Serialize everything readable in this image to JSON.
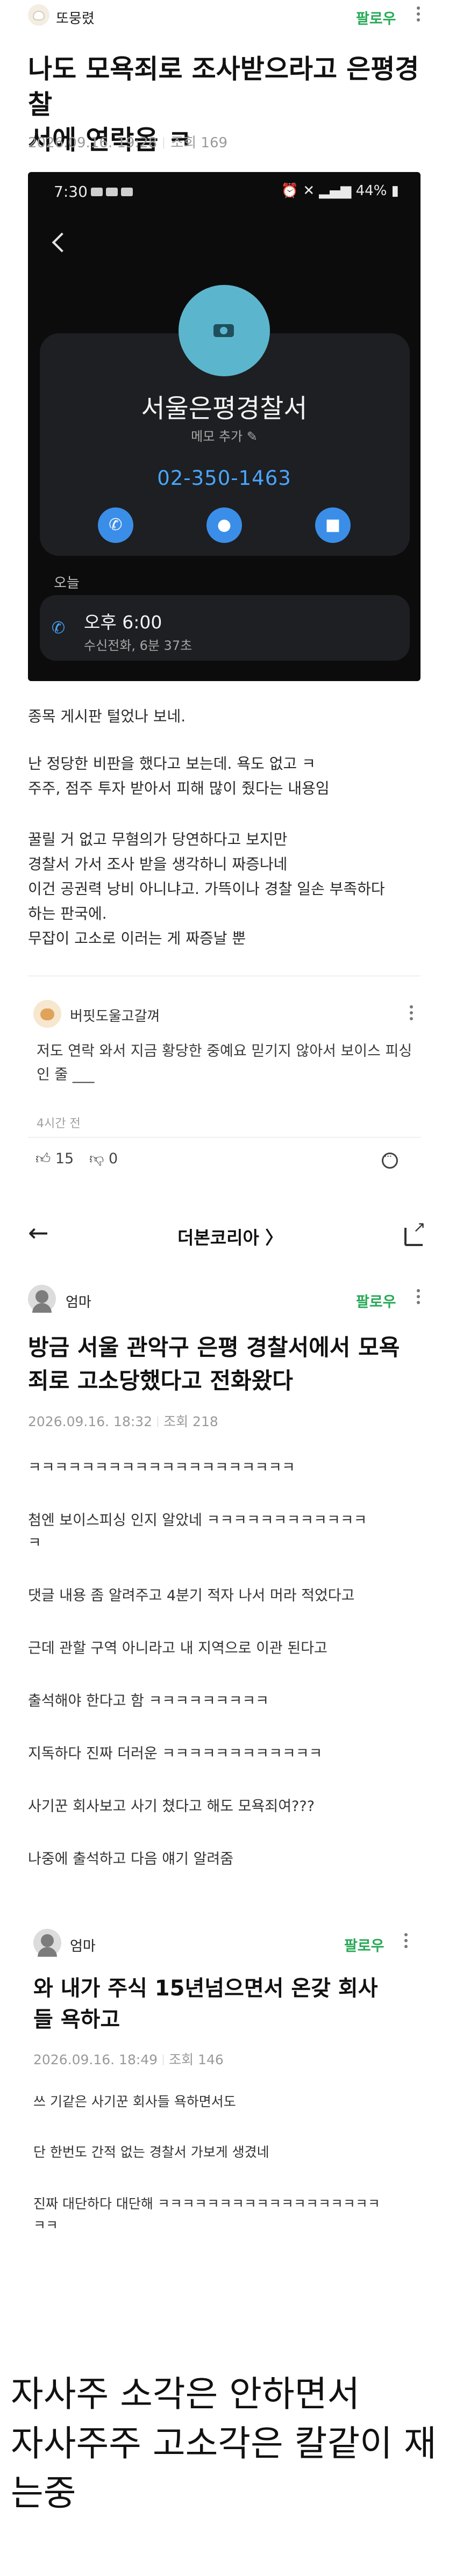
{
  "post": {
    "author": "또뭉렸",
    "follow": "팔로우",
    "title_line1": "나도 모욕죄로 조사받으라고 은평경찰",
    "title_line2": "서에 연락옴 ㅋ",
    "date": "2026.09.16. 19:28",
    "views": "조회 169"
  },
  "phone": {
    "time": "7:30",
    "battery": "44%",
    "contact_name": "서울은평경찰서",
    "memo": "메모 추가 ✎",
    "number": "02-350-1463",
    "today": "오늘",
    "call_time": "오후 6:00",
    "call_info": "수신전화, 6분 37초"
  },
  "body": [
    "종목 게시판 털었나 보네.",
    "난 정당한 비판을 했다고 보는데. 욕도 없고 ㅋ",
    "주주, 점주 투자 받아서 피해 많이 줬다는 내용임",
    "꿀릴 거 없고 무혐의가 당연하다고 보지만",
    "경찰서 가서 조사 받을 생각하니 짜증나네",
    "이건 공권력 낭비 아니냐고. 가뜩이나 경찰 일손 부족하다",
    "하는 판국에.",
    "무잡이 고소로 이러는 게 짜증날 뿐"
  ],
  "comment": {
    "name": "버핏도울고갈껴",
    "text_line1": "저도 연락 와서 지금 황당한 중예요 믿기지 않아서 보이스 피싱",
    "text_line2": "인 줄 ___",
    "time": "4시간 전",
    "likes": "15",
    "dislikes": "0"
  },
  "nav": {
    "title": "더본코리아 〉"
  },
  "sub_post": {
    "author": "엄마",
    "follow": "팔로우",
    "title_line1": "방금 서울 관악구 은평 경찰서에서 모욕",
    "title_line2": "죄로 고소당했다고 전화왔다",
    "date": "2026.09.16. 18:32",
    "views": "조회 218",
    "lines": [
      "ㅋㅋㅋㅋㅋㅋㅋㅋㅋㅋㅋㅋㅋㅋㅋㅋㅋㅋㅋㅋ",
      "첨엔 보이스피싱 인지 알았네 ㅋㅋㅋㅋㅋㅋㅋㅋㅋㅋㅋㅋ",
      "ㅋ",
      "댓글 내용  좀 알려주고 4분기 적자 나서 머라 적었다고",
      "근데 관할 구역 아니라고 내 지역으로 이관 된다고",
      "출석해야 한다고 함 ㅋㅋㅋㅋㅋㅋㅋㅋㅋ",
      "지독하다 진짜 더러운 ㅋㅋㅋㅋㅋㅋㅋㅋㅋㅋㅋㅋ",
      "사기꾼 회사보고 사기 쳤다고 해도 모욕죄여???",
      "나중에 출석하고 다음 얘기 알려줌"
    ]
  },
  "sub_post2": {
    "author": "엄마",
    "follow": "팔로우",
    "title_line1": "와 내가 주식 15년넘으면서 온갖 회사",
    "title_line2": "들 욕하고",
    "date": "2026.09.16. 18:49",
    "views": "조회 146",
    "lines": [
      "쓰 기같은 사기꾼 회사들 욕하면서도",
      "단 한번도 간적 없는 경찰서 가보게 생겼네",
      "진짜 대단하다 대단해 ㅋㅋㅋㅋㅋㅋㅋㅋㅋㅋㅋㅋㅋㅋㅋㅋㅋㅋ",
      "ㅋㅋ"
    ]
  },
  "caption": {
    "line1": "자사주 소각은 안하면서",
    "line2": "자사주주 고소각은 칼같이 재",
    "line3": "는중"
  },
  "colors": {
    "follow": "#27a957",
    "phone_accent": "#4aa6ff",
    "avatar_blue": "#5bb6cd"
  },
  "icons": [
    "back-chevron-icon",
    "message-icon",
    "video-icon",
    "phone-icon",
    "like-icon",
    "dislike-icon",
    "more-icon",
    "share-icon",
    "back-arrow-icon",
    "kebab-icon"
  ]
}
